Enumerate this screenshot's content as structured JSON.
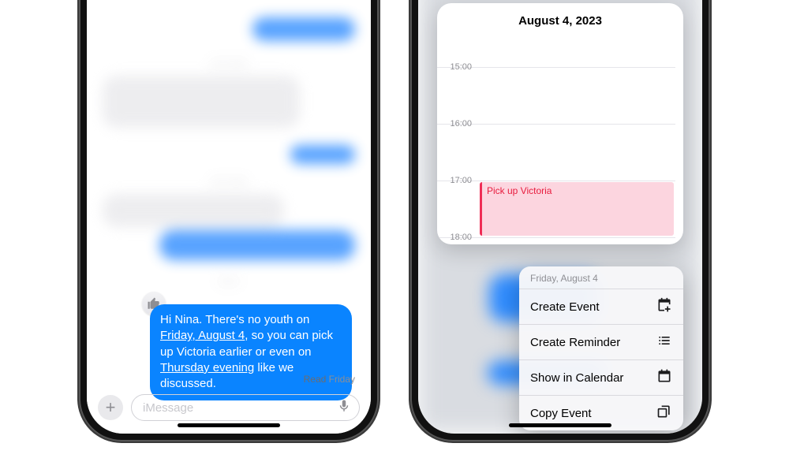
{
  "left": {
    "bubble": {
      "t1": "Hi Nina. There's no youth on ",
      "link1": "Friday, August 4",
      "t2": ", so you can pick up Victoria earlier or even on ",
      "link2": "Thursday evening",
      "t3": " like we discussed."
    },
    "receipt_bold": "Read",
    "receipt_time": " Friday",
    "compose_placeholder": "iMessage"
  },
  "right": {
    "cal_title": "August 4, 2023",
    "hours": {
      "h15": "15:00",
      "h16": "16:00",
      "h17": "17:00",
      "h18": "18:00"
    },
    "event_title": "Pick up Victoria",
    "menu_date": "Friday, August 4",
    "menu": {
      "create_event": "Create Event",
      "create_reminder": "Create Reminder",
      "show_calendar": "Show in Calendar",
      "copy_event": "Copy Event"
    }
  }
}
